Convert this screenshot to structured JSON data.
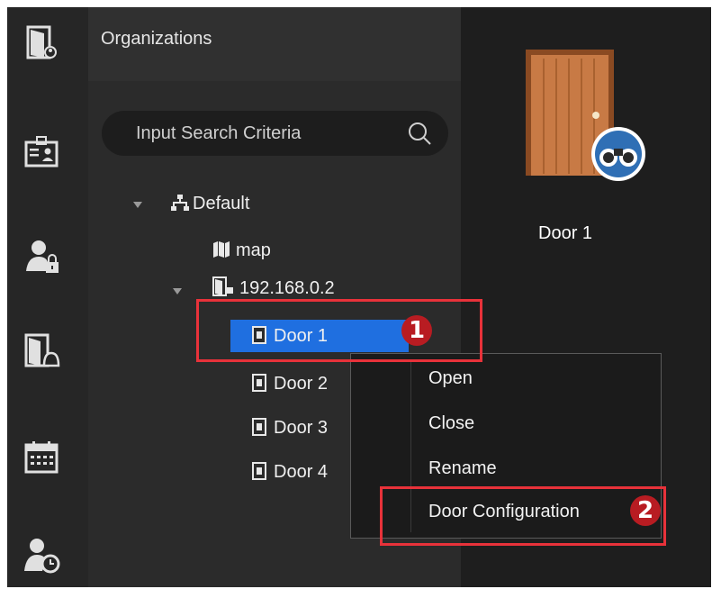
{
  "sidebar": {
    "icons": [
      {
        "name": "door-access-icon"
      },
      {
        "name": "id-card-icon"
      },
      {
        "name": "user-lock-icon"
      },
      {
        "name": "door-alarm-icon"
      },
      {
        "name": "calendar-icon"
      },
      {
        "name": "user-clock-icon"
      }
    ]
  },
  "tree_panel": {
    "title": "Organizations",
    "search": {
      "placeholder": "Input Search Criteria"
    },
    "nodes": [
      {
        "label": "Default"
      },
      {
        "label": "map"
      },
      {
        "label": "192.168.0.2"
      },
      {
        "label": "Door 1",
        "selected": true
      },
      {
        "label": "Door 2"
      },
      {
        "label": "Door 3"
      },
      {
        "label": "Door 4"
      }
    ]
  },
  "context_menu": {
    "items": [
      {
        "label": "Open"
      },
      {
        "label": "Close"
      },
      {
        "label": "Rename"
      },
      {
        "label": "Door Configuration"
      }
    ]
  },
  "preview": {
    "door_label": "Door 1"
  },
  "annotations": {
    "step1": "1",
    "step2": "2"
  },
  "colors": {
    "selection": "#1f6fe0",
    "annotation": "#e8323a",
    "door": "#c87a45"
  }
}
